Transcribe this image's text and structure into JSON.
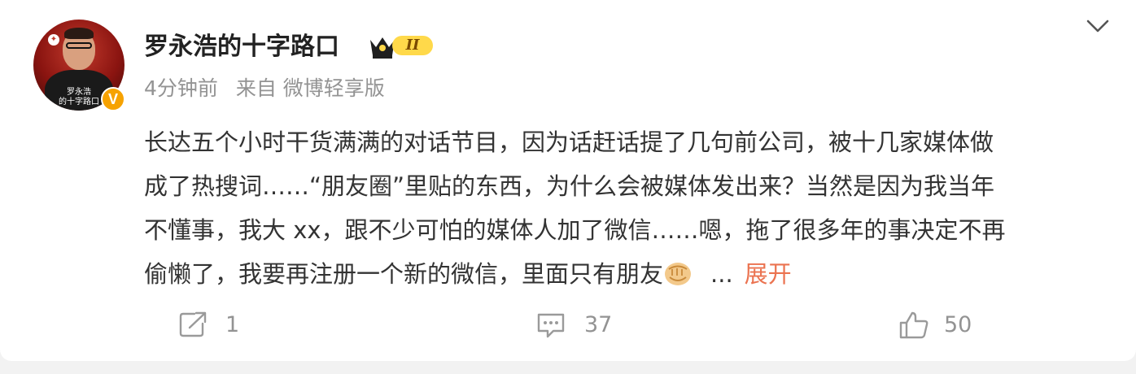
{
  "post": {
    "author": {
      "name": "罗永浩的十字路口",
      "level_badge": "II",
      "avatar_caption": "罗永浩\n的十字路口",
      "verified_mark": "V"
    },
    "meta": {
      "time": "4分钟前",
      "source": "来自 微博轻享版"
    },
    "content": {
      "lines": [
        "长达五个小时干货满满的对话节目，因为话赶话提了几句前公司，被十几家媒体做",
        "成了热搜词……“朋友圈”里贴的东西，为什么会被媒体发出来？当然是因为我当年",
        "不懂事，我大 xx，跟不少可怕的媒体人加了微信……嗯，拖了很多年的事决定不再",
        "偷懒了，我要再注册一个新的微信，里面只有朋友"
      ],
      "emoji": "fist-emoji",
      "ellipsis": "...",
      "expand_label": "展开"
    },
    "actions": {
      "repost": {
        "icon": "share-icon",
        "count": "1"
      },
      "comment": {
        "icon": "comment-icon",
        "count": "37"
      },
      "like": {
        "icon": "thumbs-up-icon",
        "count": "50"
      }
    },
    "menu_icon": "chevron-down-icon"
  },
  "colors": {
    "text": "#333333",
    "muted": "#939393",
    "accent": "#eb7350",
    "badge_gold": "#f6a200",
    "background": "#f2f2f2"
  }
}
